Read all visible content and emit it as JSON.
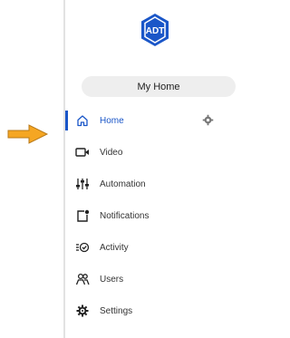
{
  "brand": {
    "logo_text": "ADT",
    "color": "#1a56c8"
  },
  "home_selector": {
    "label": "My Home"
  },
  "nav": [
    {
      "label": "Home",
      "icon": "house-icon",
      "active": true
    },
    {
      "label": "Video",
      "icon": "video-camera-icon"
    },
    {
      "label": "Automation",
      "icon": "sliders-icon"
    },
    {
      "label": "Notifications",
      "icon": "notification-bell-icon"
    },
    {
      "label": "Activity",
      "icon": "activity-list-icon"
    },
    {
      "label": "Users",
      "icon": "users-icon"
    },
    {
      "label": "Settings",
      "icon": "settings-gear-icon"
    }
  ],
  "pointer": {
    "color": "#f5a623",
    "icon": "arrow-right-icon"
  }
}
